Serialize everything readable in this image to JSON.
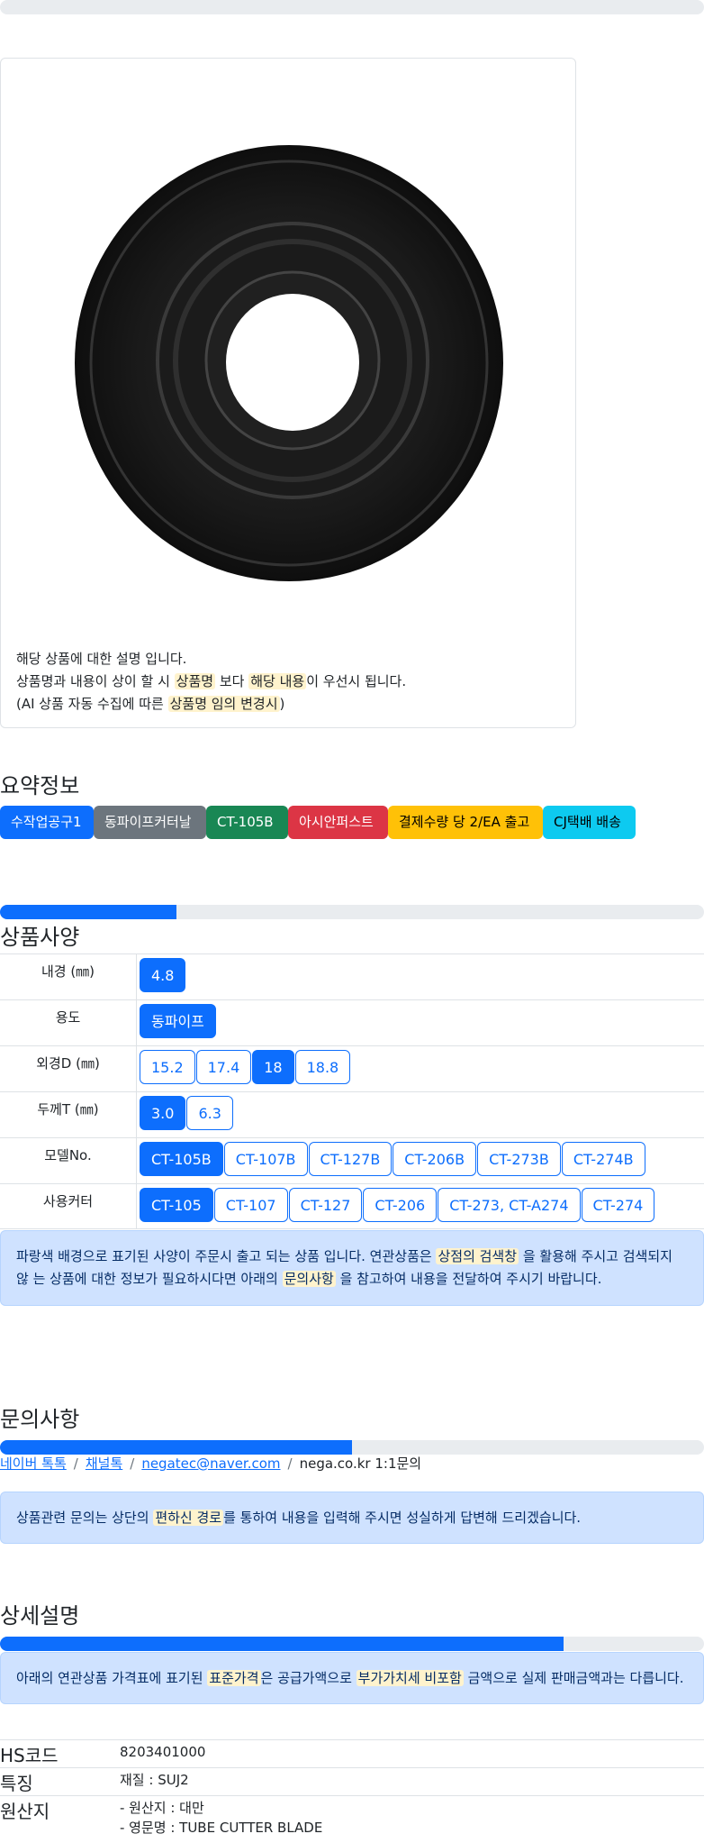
{
  "product": {
    "image_alt": "tube cutter blade",
    "desc_line1": "해당 상품에 대한 설명 입니다.",
    "desc_line2_a": "상품명과 내용이 상이 할 시",
    "desc_line2_hl1": "상품명",
    "desc_line2_b": "보다",
    "desc_line2_hl2": "해당 내용",
    "desc_line2_c": "이 우선시 됩니다.",
    "desc_line3_a": "(AI 상품 자동 수집에 따른",
    "desc_line3_hl": "상품명 임의 변경시",
    "desc_line3_b": ")"
  },
  "summary": {
    "title": "요약정보",
    "badges": [
      "수작업공구1",
      "동파이프커터날",
      "CT-105B",
      "아시안퍼스트",
      "결제수량 당 2/EA 출고",
      "CJ택배 배송"
    ]
  },
  "spec": {
    "title": "상품사양",
    "progress": 0.25,
    "rows": [
      {
        "label": "내경 (㎜)",
        "options": [
          "4.8"
        ],
        "selected": 0
      },
      {
        "label": "용도",
        "options": [
          "동파이프"
        ],
        "selected": 0
      },
      {
        "label": "외경D (㎜)",
        "options": [
          "15.2",
          "17.4",
          "18",
          "18.8"
        ],
        "selected": 2
      },
      {
        "label": "두께T (㎜)",
        "options": [
          "3.0",
          "6.3"
        ],
        "selected": 0
      },
      {
        "label": "모델No.",
        "options": [
          "CT-105B",
          "CT-107B",
          "CT-127B",
          "CT-206B",
          "CT-273B",
          "CT-274B"
        ],
        "selected": 0
      },
      {
        "label": "사용커터",
        "options": [
          "CT-105",
          "CT-107",
          "CT-127",
          "CT-206",
          "CT-273, CT-A274",
          "CT-274"
        ],
        "selected": 0
      }
    ],
    "notice_a": "파랑색 배경으로 표기된 사양이 주문시 출고 되는 상품 입니다. 연관상품은",
    "notice_hl1": "상점의 검색창",
    "notice_b": "을 활용해 주시고 검색되지 않",
    "notice_c": "는 상품에 대한 정보가 필요하시다면 아래의",
    "notice_hl2": "문의사항",
    "notice_d": "을 참고하여 내용을 전달하여 주시기 바랍니다."
  },
  "inquiry": {
    "title": "문의사항",
    "progress": 0.5,
    "links": [
      "네이버 톡톡",
      "채널톡",
      "negatec@naver.com"
    ],
    "current": "nega.co.kr 1:1문의",
    "notice_a": "상품관련 문의는 상단의",
    "notice_hl": "편하신 경로",
    "notice_b": "를 통하여 내용을 입력해 주시면 성실하게 답변해 드리겠습니다."
  },
  "detail": {
    "title": "상세설명",
    "progress": 0.8,
    "notice_a": "아래의 연관상품 가격표에 표기된",
    "notice_hl1": "표준가격",
    "notice_b": "은 공급가액으로",
    "notice_hl2": "부가가치세 비포함",
    "notice_c": "금액으로 실제 판매금액과는 다릅니다."
  },
  "info": {
    "hs_key": "HS코드",
    "hs_val": "8203401000",
    "feature_key": "특징",
    "feature_val": "재질 : SUJ2",
    "origin_key": "원산지",
    "origin_val1": "- 원산지 : 대만",
    "origin_val2": "- 영문명 : TUBE CUTTER BLADE"
  },
  "colors": {
    "primary": "#0d6efd",
    "highlight": "#fff3cd",
    "alert_bg": "#cfe2ff"
  }
}
